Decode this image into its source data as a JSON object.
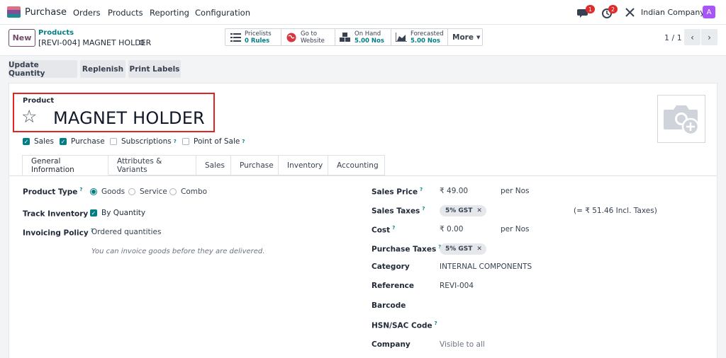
{
  "nav": {
    "app": "Purchase",
    "menu": [
      "Orders",
      "Products",
      "Reporting",
      "Configuration"
    ],
    "chat_badge": "1",
    "activity_badge": "2",
    "company": "Indian Company",
    "avatar": "A"
  },
  "control": {
    "new_label": "New",
    "breadcrumb_parent": "Products",
    "breadcrumb_record": "[REVI-004] MAGNET HOLDER",
    "smart_buttons": [
      {
        "label": "Pricelists",
        "value": "0 Rules"
      },
      {
        "label": "Go to",
        "value": "Website"
      },
      {
        "label": "On Hand",
        "value": "5.00 Nos"
      },
      {
        "label": "Forecasted",
        "value": "5.00 Nos"
      }
    ],
    "more_label": "More",
    "pager": "1 / 1"
  },
  "actions": [
    "Update Quantity",
    "Replenish",
    "Print Labels"
  ],
  "product": {
    "label": "Product",
    "name": "MAGNET HOLDER",
    "checks": [
      {
        "label": "Sales",
        "checked": true
      },
      {
        "label": "Purchase",
        "checked": true
      },
      {
        "label": "Subscriptions",
        "checked": false
      },
      {
        "label": "Point of Sale",
        "checked": false
      }
    ]
  },
  "tabs": [
    "General Information",
    "Attributes & Variants",
    "Sales",
    "Purchase",
    "Inventory",
    "Accounting"
  ],
  "left": {
    "product_type_label": "Product Type",
    "product_type_options": [
      "Goods",
      "Service",
      "Combo"
    ],
    "selected_type": "Goods",
    "track_inventory_label": "Track Inventory",
    "track_inventory_value": "By Quantity",
    "invoicing_policy_label": "Invoicing Policy",
    "invoicing_policy_value": "Ordered quantities",
    "invoicing_hint": "You can invoice goods before they are delivered."
  },
  "right": {
    "sales_price_label": "Sales Price",
    "sales_price": "₹ 49.00",
    "sales_price_unit": "per Nos",
    "sales_taxes_label": "Sales Taxes",
    "sales_tax_tag": "5% GST",
    "incl_taxes": "(= ₹ 51.46 Incl. Taxes)",
    "cost_label": "Cost",
    "cost": "₹ 0.00",
    "cost_unit": "per Nos",
    "purchase_taxes_label": "Purchase Taxes",
    "purchase_tax_tag": "5% GST",
    "category_label": "Category",
    "category": "INTERNAL COMPONENTS",
    "reference_label": "Reference",
    "reference": "REVI-004",
    "barcode_label": "Barcode",
    "hsn_label": "HSN/SAC Code",
    "company_label": "Company",
    "company_placeholder": "Visible to all"
  },
  "colors": {
    "accent": "#017e84",
    "brand": "#714b67",
    "highlight": "#e02424"
  }
}
